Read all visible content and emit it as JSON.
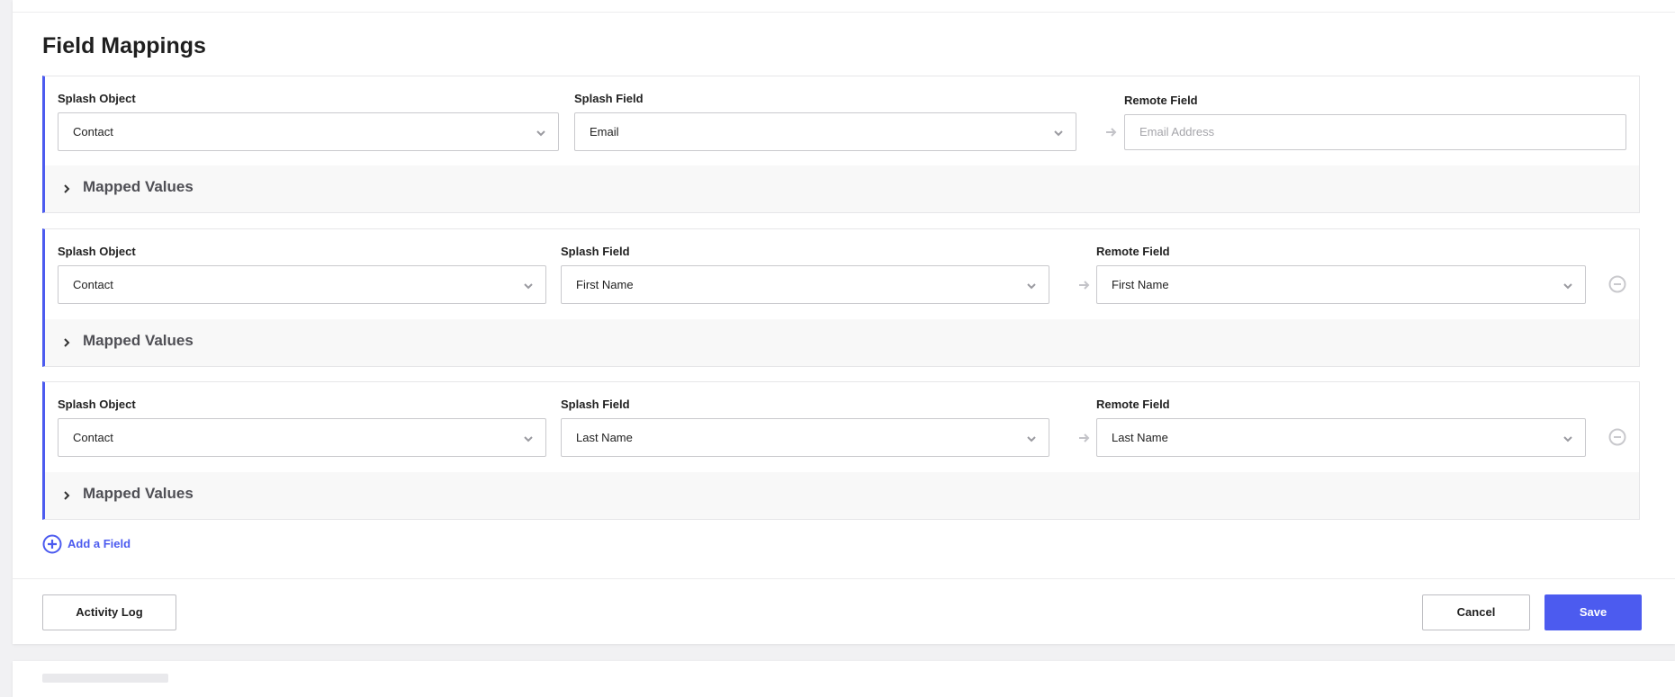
{
  "section": {
    "title": "Field Mappings"
  },
  "labels": {
    "splash_object": "Splash Object",
    "splash_field": "Splash Field",
    "remote_field": "Remote Field",
    "mapped_values": "Mapped Values"
  },
  "mappings": [
    {
      "splash_object": "Contact",
      "splash_field": "Email",
      "remote_field_placeholder": "Email Address"
    },
    {
      "splash_object": "Contact",
      "splash_field": "First Name",
      "remote_field": "First Name"
    },
    {
      "splash_object": "Contact",
      "splash_field": "Last Name",
      "remote_field": "Last Name"
    }
  ],
  "actions": {
    "add_field": "Add a Field",
    "activity_log": "Activity Log",
    "cancel": "Cancel",
    "save": "Save"
  },
  "icons": {
    "chevron": "chevron-down-icon",
    "arrow": "arrow-right-icon",
    "remove": "minus-circle-icon",
    "add": "plus-circle-icon",
    "caret": "caret-right-icon"
  },
  "colors": {
    "accent": "#4c5bef",
    "panel_bg": "#f8f8f8",
    "border": "#c9c9cd"
  }
}
